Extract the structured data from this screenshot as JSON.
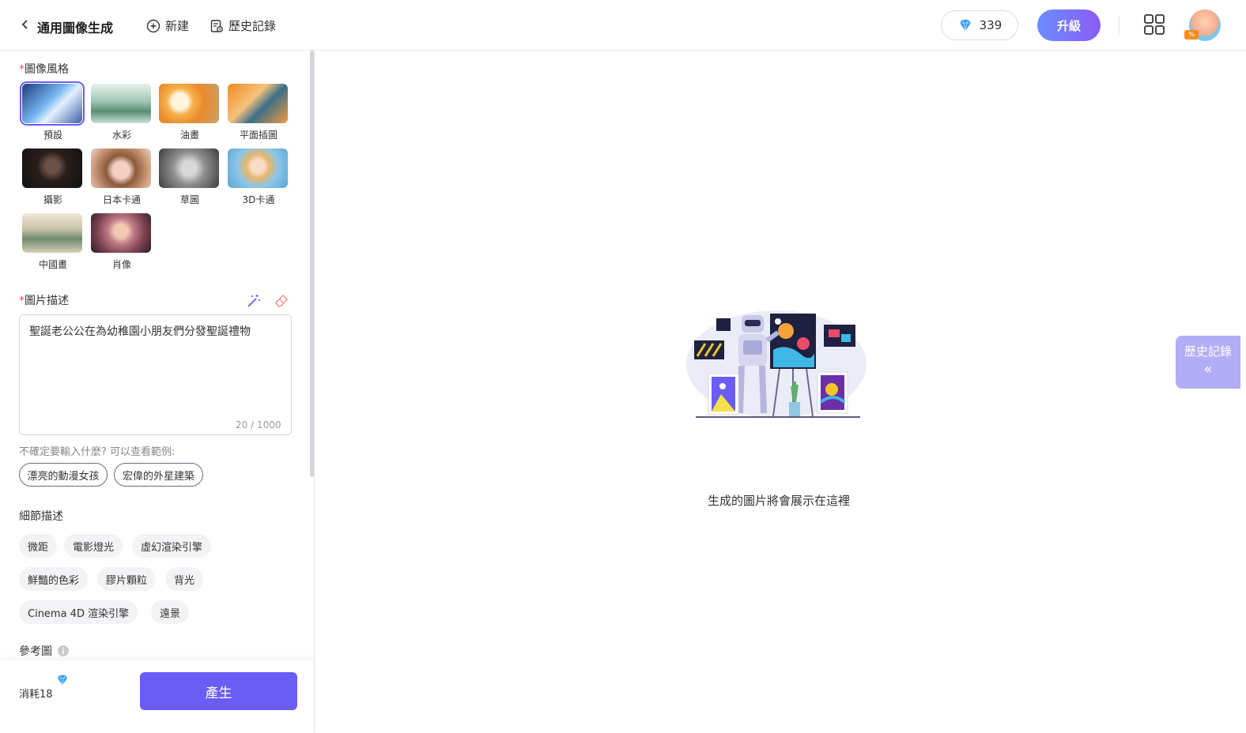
{
  "header": {
    "title": "通用圖像生成",
    "new_label": "新建",
    "history_label": "歷史記錄",
    "credits": "339",
    "upgrade_label": "升級"
  },
  "left": {
    "style_section_label": "圖像風格",
    "styles": [
      {
        "label": "預設",
        "selected": true
      },
      {
        "label": "水彩",
        "selected": false
      },
      {
        "label": "油畫",
        "selected": false
      },
      {
        "label": "平面插圖",
        "selected": false
      },
      {
        "label": "攝影",
        "selected": false
      },
      {
        "label": "日本卡通",
        "selected": false
      },
      {
        "label": "草圖",
        "selected": false
      },
      {
        "label": "3D卡通",
        "selected": false
      },
      {
        "label": "中國畫",
        "selected": false
      },
      {
        "label": "肖像",
        "selected": false
      }
    ],
    "desc_section_label": "圖片描述",
    "description_value": "聖誕老公公在為幼稚園小朋友們分發聖誕禮物",
    "counter": "20 / 1000",
    "hint": "不確定要輸入什麼? 可以查看範例:",
    "examples": [
      "漂亮的動漫女孩",
      "宏偉的外星建築"
    ],
    "detail_section_label": "細節描述",
    "detail_tags": [
      "微距",
      "電影燈光",
      "虛幻渲染引擎",
      "鮮豔的色彩",
      "膠片顆粒",
      "背光",
      "Cinema 4D 渲染引擎",
      "遠景"
    ],
    "reference_label": "參考圖",
    "cost_label": "消耗18",
    "generate_label": "產生"
  },
  "main": {
    "empty_text": "生成的圖片將會展示在這裡",
    "history_tab_label": "歷史記錄"
  },
  "colors": {
    "accent": "#6b5cf6",
    "history_tab": "#b3adf5"
  },
  "icons": [
    "chevron-left-icon",
    "plus-circle-icon",
    "history-icon",
    "diamond-icon",
    "apps-grid-icon",
    "magic-wand-icon",
    "eraser-icon",
    "info-icon",
    "chevron-double-left-icon"
  ]
}
